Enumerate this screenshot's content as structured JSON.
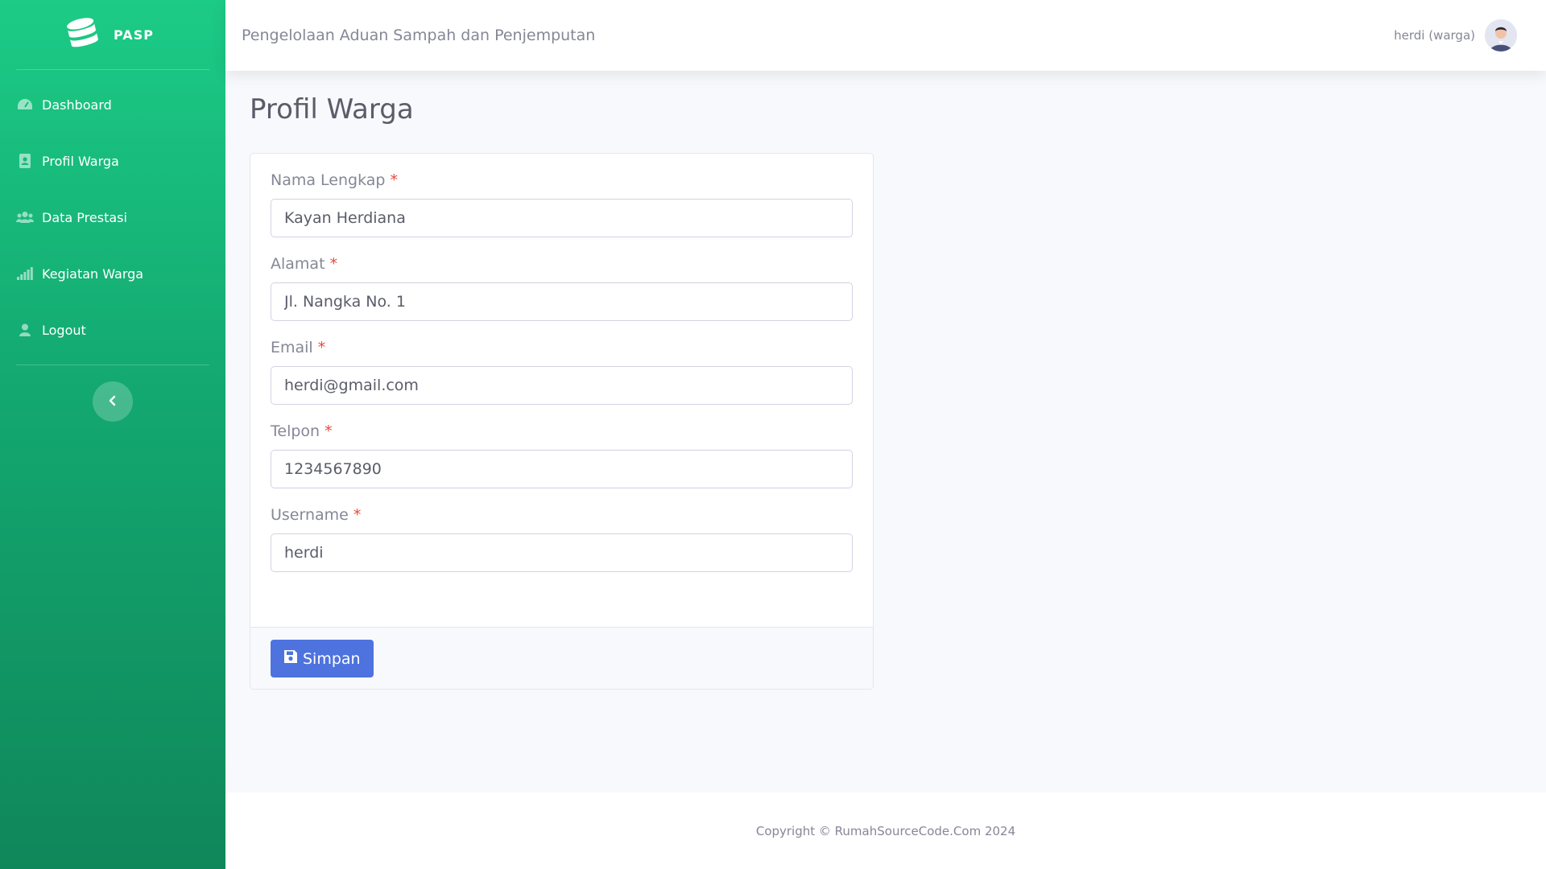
{
  "sidebar": {
    "brand": "PASP",
    "items": [
      {
        "label": "Dashboard",
        "icon": "tachometer-icon"
      },
      {
        "label": "Profil Warga",
        "icon": "address-book-icon"
      },
      {
        "label": "Data Prestasi",
        "icon": "users-icon"
      },
      {
        "label": "Kegiatan Warga",
        "icon": "signal-icon"
      },
      {
        "label": "Logout",
        "icon": "user-icon"
      }
    ],
    "toggle_icon": "chevron-left-icon"
  },
  "topbar": {
    "title": "Pengelolaan Aduan Sampah dan Penjemputan",
    "user": "herdi (warga)"
  },
  "page": {
    "title": "Profil Warga"
  },
  "form": {
    "required_mark": "*",
    "fields": [
      {
        "label": "Nama Lengkap",
        "value": "Kayan Herdiana"
      },
      {
        "label": "Alamat",
        "value": "Jl. Nangka No. 1"
      },
      {
        "label": "Email",
        "value": "herdi@gmail.com"
      },
      {
        "label": "Telpon",
        "value": "1234567890"
      },
      {
        "label": "Username",
        "value": "herdi"
      }
    ],
    "save_label": "Simpan"
  },
  "footer": {
    "copyright": "Copyright © RumahSourceCode.Com 2024"
  },
  "colors": {
    "sidebar_top": "#1ccb86",
    "sidebar_bottom": "#10875a",
    "primary": "#4e73df",
    "required": "#e74a3b"
  }
}
